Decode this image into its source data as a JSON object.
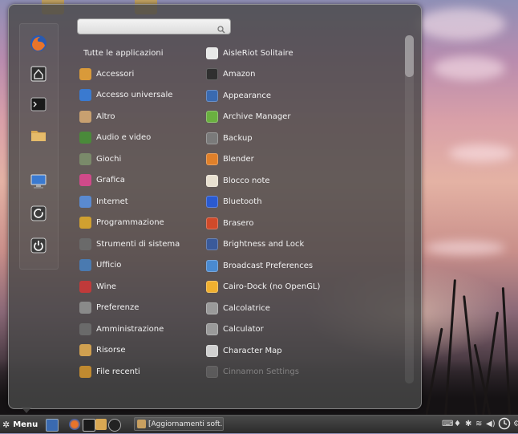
{
  "menu": {
    "search": {
      "value": "",
      "placeholder": ""
    },
    "all_apps_label": "Tutte le applicazioni",
    "favorites": [
      {
        "name": "firefox-icon"
      },
      {
        "name": "software-center-icon"
      },
      {
        "name": "terminal-icon"
      },
      {
        "name": "folder-icon"
      },
      {
        "name": "display-icon"
      },
      {
        "name": "logout-icon"
      },
      {
        "name": "power-icon"
      }
    ],
    "categories": [
      {
        "label": "Accessori",
        "icon": "accessories-icon",
        "color": "#d99a3a"
      },
      {
        "label": "Accesso universale",
        "icon": "accessibility-icon",
        "color": "#3a7ad0"
      },
      {
        "label": "Altro",
        "icon": "other-icon",
        "color": "#c8a070"
      },
      {
        "label": "Audio e video",
        "icon": "multimedia-icon",
        "color": "#4a8a3a"
      },
      {
        "label": "Giochi",
        "icon": "games-icon",
        "color": "#7a8a6a"
      },
      {
        "label": "Grafica",
        "icon": "graphics-icon",
        "color": "#d04a8a"
      },
      {
        "label": "Internet",
        "icon": "internet-icon",
        "color": "#5a8ad0"
      },
      {
        "label": "Programmazione",
        "icon": "programming-icon",
        "color": "#d0a030"
      },
      {
        "label": "Strumenti di sistema",
        "icon": "system-tools-icon",
        "color": "#6a6a6a"
      },
      {
        "label": "Ufficio",
        "icon": "office-icon",
        "color": "#4a7ab0"
      },
      {
        "label": "Wine",
        "icon": "wine-icon",
        "color": "#c03a3a"
      },
      {
        "label": "Preferenze",
        "icon": "preferences-icon",
        "color": "#8a8a8a"
      },
      {
        "label": "Amministrazione",
        "icon": "administration-icon",
        "color": "#6a6a6a"
      },
      {
        "label": "Risorse",
        "icon": "places-icon",
        "color": "#d0a050"
      },
      {
        "label": "File recenti",
        "icon": "recent-files-icon",
        "color": "#c08a30"
      }
    ],
    "apps": [
      {
        "label": "AisleRiot Solitaire",
        "icon": "solitaire-icon",
        "color": "#e8e8e8"
      },
      {
        "label": "Amazon",
        "icon": "amazon-icon",
        "color": "#303030"
      },
      {
        "label": "Appearance",
        "icon": "appearance-icon",
        "color": "#3a6ab0"
      },
      {
        "label": "Archive Manager",
        "icon": "archive-icon",
        "color": "#6ab040"
      },
      {
        "label": "Backup",
        "icon": "backup-icon",
        "color": "#7a7a7a"
      },
      {
        "label": "Blender",
        "icon": "blender-icon",
        "color": "#e0802a"
      },
      {
        "label": "Blocco note",
        "icon": "notepad-icon",
        "color": "#e8e0d0"
      },
      {
        "label": "Bluetooth",
        "icon": "bluetooth-icon",
        "color": "#2a5ad0"
      },
      {
        "label": "Brasero",
        "icon": "brasero-icon",
        "color": "#d04a2a"
      },
      {
        "label": "Brightness and Lock",
        "icon": "brightness-icon",
        "color": "#3a5a9a"
      },
      {
        "label": "Broadcast Preferences",
        "icon": "broadcast-icon",
        "color": "#4a8ad0"
      },
      {
        "label": "Cairo-Dock (no OpenGL)",
        "icon": "cairo-dock-icon",
        "color": "#f0b030"
      },
      {
        "label": "Calcolatrice",
        "icon": "calculator-icon",
        "color": "#9a9a9a"
      },
      {
        "label": "Calculator",
        "icon": "calculator-icon",
        "color": "#9a9a9a"
      },
      {
        "label": "Character Map",
        "icon": "charmap-icon",
        "color": "#d0d0d0"
      },
      {
        "label": "Cinnamon Settings",
        "icon": "cinnamon-settings-icon",
        "color": "#8a8a8a"
      }
    ]
  },
  "taskbar": {
    "menu_label": "Menu",
    "window_title": "[Aggiornamenti soft..."
  }
}
